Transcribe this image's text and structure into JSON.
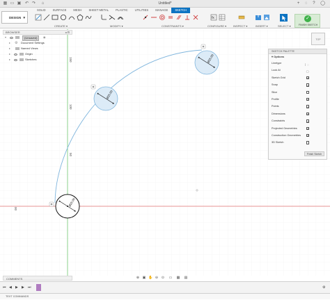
{
  "window": {
    "document_title": "Untitled*"
  },
  "workspace": {
    "label": "DESIGN"
  },
  "tabs": [
    "SOLID",
    "SURFACE",
    "MESH",
    "SHEET METAL",
    "PLASTIC",
    "UTILITIES",
    "MANAGE",
    "SKETCH"
  ],
  "active_tab": "SKETCH",
  "tool_groups": {
    "create": "CREATE",
    "modify": "MODIFY",
    "constraints": "CONSTRAINTS",
    "configure": "CONFIGURE",
    "inspect": "INSPECT",
    "insert": "INSERT",
    "select": "SELECT",
    "finish": "FINISH SKETCH"
  },
  "browser": {
    "title": "BROWSER",
    "root": "(Unsaved)",
    "items": [
      "Document Settings",
      "Named Views",
      "Origin",
      "Sketches"
    ]
  },
  "sketch_palette": {
    "title": "SKETCH PALETTE",
    "section": "Options",
    "options": [
      {
        "label": "Linetype",
        "kind": "icon"
      },
      {
        "label": "Look At",
        "kind": "icon"
      },
      {
        "label": "Sketch Grid",
        "checked": true
      },
      {
        "label": "Snap",
        "checked": true
      },
      {
        "label": "Slice",
        "checked": false
      },
      {
        "label": "Profile",
        "checked": true
      },
      {
        "label": "Points",
        "checked": true
      },
      {
        "label": "Dimensions",
        "checked": true
      },
      {
        "label": "Constraints",
        "checked": true
      },
      {
        "label": "Projected Geometries",
        "checked": true
      },
      {
        "label": "Construction Geometries",
        "checked": true
      },
      {
        "label": "3D Sketch",
        "checked": false
      }
    ],
    "finish_label": "Finish Sketch"
  },
  "viewport": {
    "ruler_labels": [
      "150",
      "100",
      "50"
    ],
    "origin_label": "00",
    "dimensions": [
      "Ø25.00",
      "Ø25.00",
      "Ø25.00"
    ]
  },
  "comments_label": "COMMENTS",
  "text_commands_label": "TEXT COMMANDS",
  "colors": {
    "accent": "#0c73c2",
    "sketch_line": "#7fb5dd",
    "circle_fill": "#dcebf7",
    "axis_red": "#e07070",
    "axis_green": "#5cc05c"
  }
}
